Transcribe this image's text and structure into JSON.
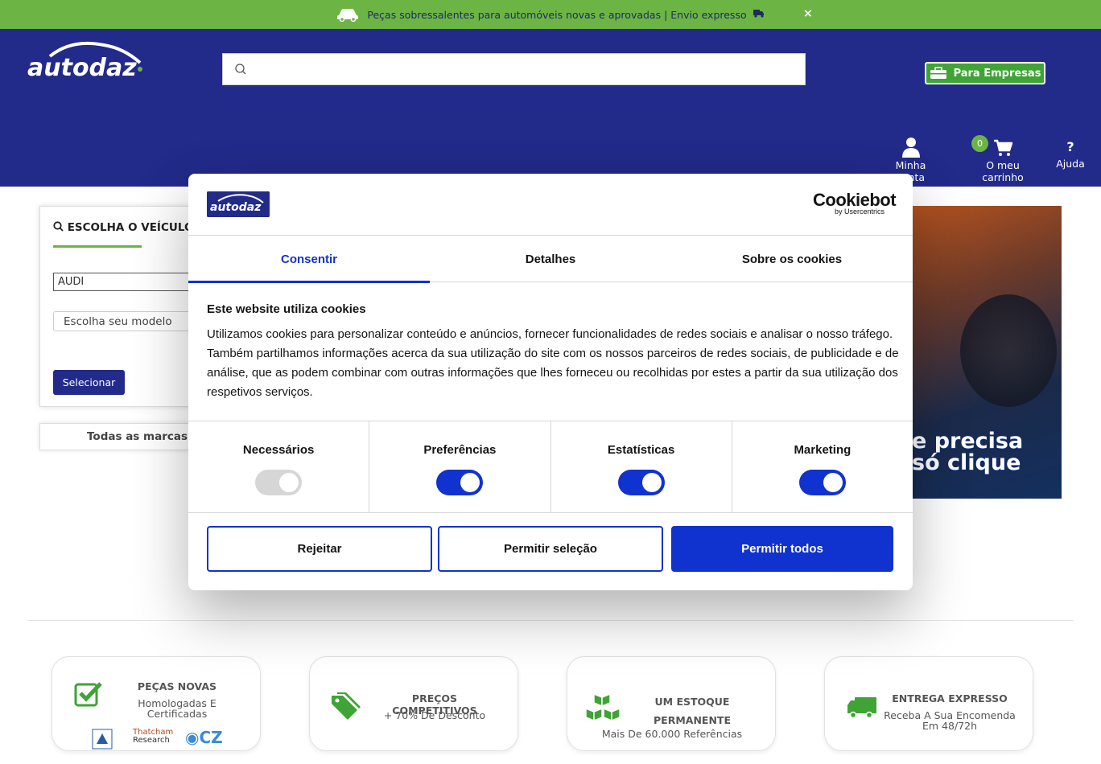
{
  "announcement": {
    "text": "Peças sobressalentes para automóveis novas e aprovadas | Envio expresso",
    "close_icon": "×"
  },
  "header": {
    "logo_text": "autodaz",
    "search": {
      "placeholder": ""
    },
    "business_button": "Para Empresas",
    "nav": {
      "account": "Minha conta",
      "cart": "O meu carrinho",
      "cart_count": "0",
      "help": "Ajuda",
      "help_icon": "?"
    }
  },
  "vehicle_selector": {
    "title": "ESCOLHA O VEÍCULO",
    "brand_value": "AUDI",
    "model_placeholder": "Escolha seu modelo",
    "select_button": "Selecionar",
    "all_brands": "Todas as marcas"
  },
  "banner": {
    "line1": "e precisa",
    "line2": "só clique"
  },
  "cookie_dialog": {
    "brand": "Cookiebot",
    "brand_sub": "by Usercentrics",
    "tabs": [
      "Consentir",
      "Detalhes",
      "Sobre os cookies"
    ],
    "active_tab": "Consentir",
    "heading": "Este website utiliza cookies",
    "body": "Utilizamos cookies para personalizar conteúdo e anúncios, fornecer funcionalidades de redes sociais e analisar o nosso tráfego. Também partilhamos informações acerca da sua utilização do site com os nossos parceiros de redes sociais, de publicidade e de análise, que as podem combinar com outras informações que lhes forneceu ou recolhidas por estes a partir da sua utilização dos respetivos serviços.",
    "categories": [
      {
        "label": "Necessários",
        "enabled": true,
        "disabled": true
      },
      {
        "label": "Preferências",
        "enabled": true
      },
      {
        "label": "Estatísticas",
        "enabled": true
      },
      {
        "label": "Marketing",
        "enabled": true
      }
    ],
    "buttons": {
      "reject": "Rejeitar",
      "allow_selection": "Permitir seleção",
      "allow_all": "Permitir todos"
    }
  },
  "features": [
    {
      "title": "PEÇAS NOVAS",
      "subtitle": "Homologadas E Certificadas",
      "badges": [
        "Thatcham",
        "Research",
        "CZ"
      ]
    },
    {
      "title": "PREÇOS COMPETITIVOS",
      "subtitle": "+ 70% De Desconto"
    },
    {
      "title": "UM ESTOQUE PERMANENTE",
      "subtitle": "Mais De 60.000 Referências"
    },
    {
      "title": "ENTREGA EXPRESSO",
      "subtitle": "Receba A Sua Encomenda Em 48/72h"
    }
  ],
  "colors": {
    "brand_blue": "#222a8a",
    "brand_green": "#6cb544",
    "cookie_blue": "#1032cf"
  }
}
